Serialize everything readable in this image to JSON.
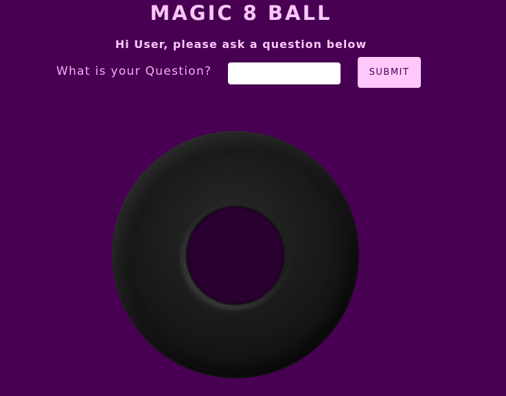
{
  "header": {
    "title": "MAGIC 8 BALL",
    "subtitle": "Hi User, please ask a question below"
  },
  "form": {
    "question_label": "What is your Question?",
    "question_value": "",
    "question_placeholder": "",
    "submit_label": "SUBMIT"
  },
  "theme": {
    "background": "#470052",
    "text_pink": "#f9c6f7",
    "button_bg": "#ffc8fb",
    "ball_color": "#1a1a1a",
    "window_color": "#2a0031"
  }
}
